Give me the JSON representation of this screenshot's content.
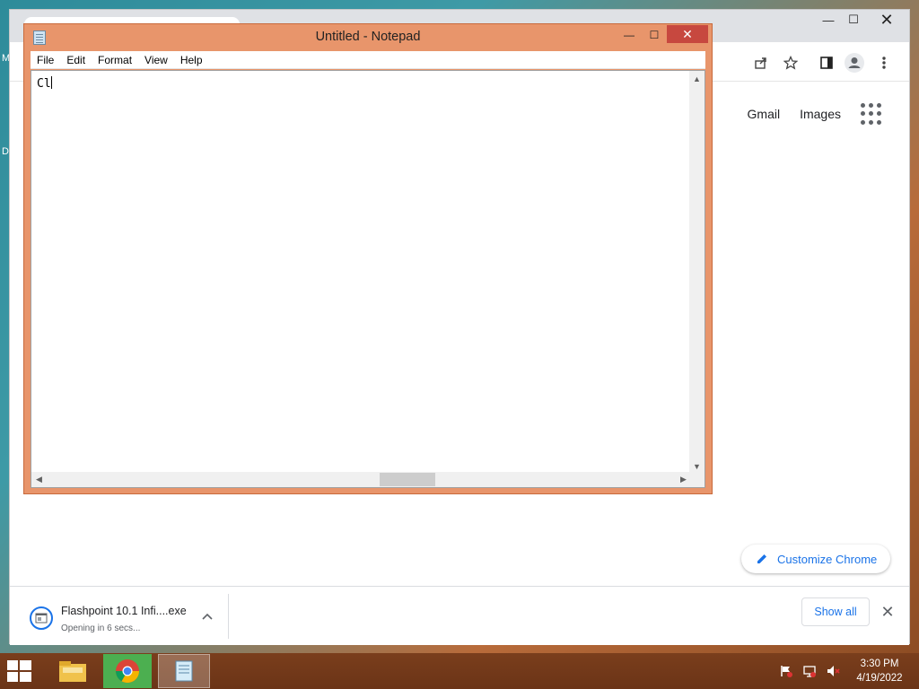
{
  "desktop": {
    "edge_label_1": "M",
    "edge_label_2": "D"
  },
  "chrome": {
    "window_controls": {
      "minimize": "—",
      "maximize": "☐",
      "close": "✕"
    },
    "toolbar_icons": [
      "share-icon",
      "star-icon",
      "side-panel-icon",
      "profile-icon",
      "more-icon"
    ],
    "header_links": [
      "Gmail",
      "Images"
    ],
    "customize_label": "Customize Chrome",
    "download": {
      "filename": "Flashpoint 10.1 Infi....exe",
      "status": "Opening in 6 secs...",
      "show_all_label": "Show all"
    },
    "accent_color": "#1a73e8"
  },
  "notepad": {
    "title": "Untitled - Notepad",
    "menu": [
      "File",
      "Edit",
      "Format",
      "View",
      "Help"
    ],
    "content": "Cl",
    "window_controls": {
      "minimize": "—",
      "maximize": "☐",
      "close": "✕"
    },
    "frame_color": "#e8956b",
    "close_color": "#c7483f"
  },
  "taskbar": {
    "apps": [
      "file-explorer",
      "chrome",
      "notepad"
    ],
    "active_app": "notepad",
    "time": "3:30 PM",
    "date": "4/19/2022"
  }
}
